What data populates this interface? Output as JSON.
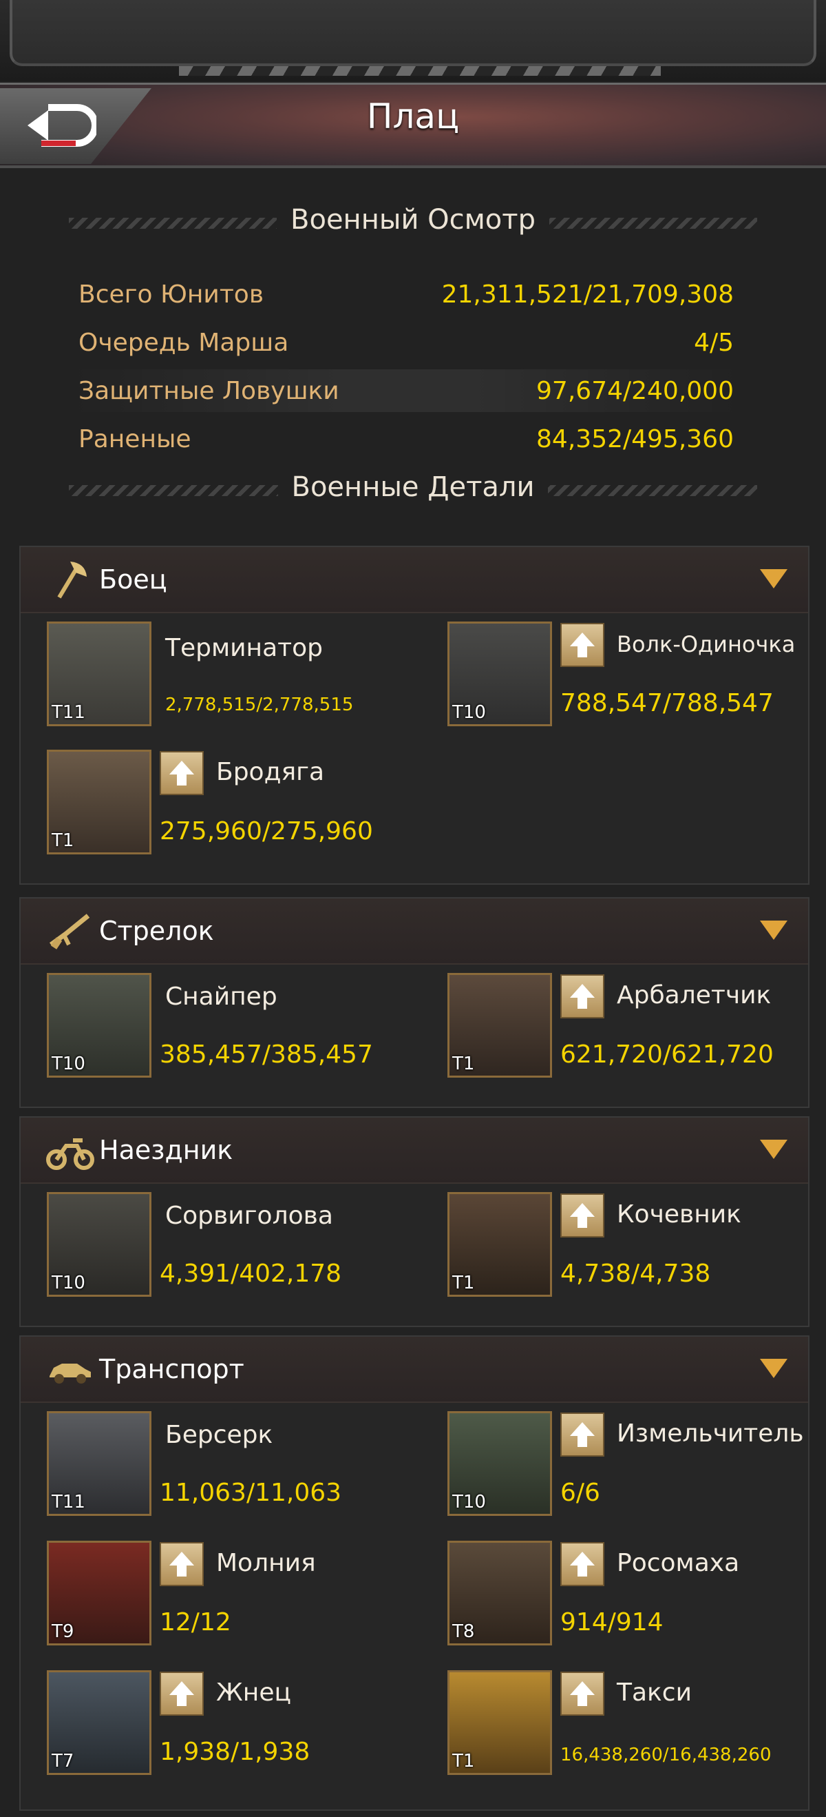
{
  "header": {
    "title": "Плац",
    "back_icon": "back-arrow-icon"
  },
  "overview": {
    "heading": "Военный Осмотр",
    "rows": [
      {
        "label": "Всего Юнитов",
        "value": "21,311,521/21,709,308"
      },
      {
        "label": "Очередь Марша",
        "value": "4/5"
      },
      {
        "label": "Защитные Ловушки",
        "value": "97,674/240,000"
      },
      {
        "label": "Раненые",
        "value": "84,352/495,360"
      }
    ]
  },
  "details": {
    "heading": "Военные Детали"
  },
  "categories": [
    {
      "title": "Боец",
      "icon": "axe-icon",
      "units": [
        {
          "name": "Терминатор",
          "tier": "T11",
          "count": "2,778,515/2,778,515"
        },
        {
          "name": "Волк-Одиночка",
          "tier": "T10",
          "count": "788,547/788,547"
        },
        {
          "name": "Бродяга",
          "tier": "T1",
          "count": "275,960/275,960"
        }
      ]
    },
    {
      "title": "Стрелок",
      "icon": "rifle-icon",
      "units": [
        {
          "name": "Снайпер",
          "tier": "T10",
          "count": "385,457/385,457"
        },
        {
          "name": "Арбалетчик",
          "tier": "T1",
          "count": "621,720/621,720"
        }
      ]
    },
    {
      "title": "Наездник",
      "icon": "motorcycle-icon",
      "units": [
        {
          "name": "Сорвиголова",
          "tier": "T10",
          "count": "4,391/402,178"
        },
        {
          "name": "Кочевник",
          "tier": "T1",
          "count": "4,738/4,738"
        }
      ]
    },
    {
      "title": "Транспорт",
      "icon": "car-icon",
      "units": [
        {
          "name": "Берсерк",
          "tier": "T11",
          "count": "11,063/11,063"
        },
        {
          "name": "Измельчитель",
          "tier": "T10",
          "count": "6/6"
        },
        {
          "name": "Молния",
          "tier": "T9",
          "count": "12/12"
        },
        {
          "name": "Росомаха",
          "tier": "T8",
          "count": "914/914"
        },
        {
          "name": "Жнец",
          "tier": "T7",
          "count": "1,938/1,938"
        },
        {
          "name": "Такси",
          "tier": "T1",
          "count": "16,438,260/16,438,260"
        }
      ]
    }
  ]
}
